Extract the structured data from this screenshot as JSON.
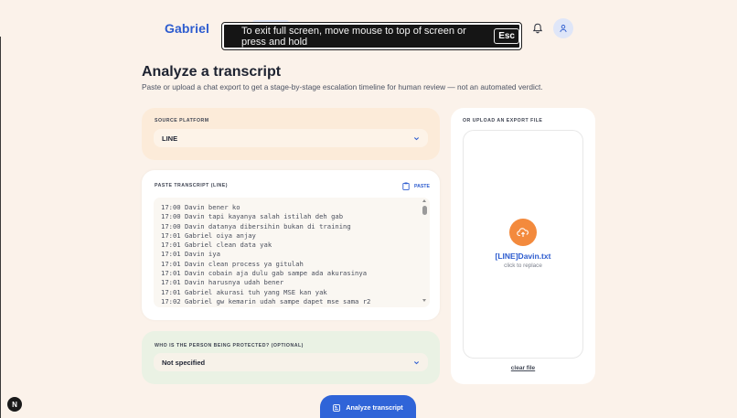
{
  "header": {
    "brand": "Gabriel"
  },
  "fullscreen_notice": {
    "text": "To exit full screen, move mouse to top of screen or press and hold",
    "key": "Esc"
  },
  "page": {
    "title": "Analyze a transcript",
    "subtitle": "Paste or upload a chat export to get a stage-by-stage escalation timeline for human review — not an automated verdict."
  },
  "source_platform": {
    "label": "SOURCE PLATFORM",
    "value": "LINE"
  },
  "transcript": {
    "label": "PASTE TRANSCRIPT (LINE)",
    "paste_label": "PASTE",
    "lines": [
      "17:00 Davin bener ko",
      "17:00 Davin tapi kayanya salah istilah deh gab",
      "17:00 Davin datanya dibersihin bukan di training",
      "17:01 Gabriel oiya anjay",
      "17:01 Gabriel clean data yak",
      "17:01 Davin iya",
      "17:01 Davin clean process ya gitulah",
      "17:01 Davin cobain aja dulu gab sampe ada akurasinya",
      "17:01 Davin harusnya udah bener",
      "17:01 Gabriel akurasi tuh yang MSE kan yak",
      "17:02 Gabriel gw kemarin udah sampe dapet mse sama r2"
    ]
  },
  "protected_person": {
    "label": "WHO IS THE PERSON BEING PROTECTED? (OPTIONAL)",
    "value": "Not specified"
  },
  "upload": {
    "label": "OR UPLOAD AN EXPORT FILE",
    "file_name": "[LINE]Davin.txt",
    "hint": "click to replace",
    "clear_label": "clear file"
  },
  "actions": {
    "analyze_label": "Analyze transcript"
  },
  "badge": {
    "letter": "N"
  },
  "colors": {
    "accent": "#2f64d8",
    "brand": "#2d5ccf",
    "upload_orange": "#f38a3d",
    "background": "#fbf2ea"
  },
  "icons": [
    "bell-icon",
    "user-icon",
    "clipboard-icon",
    "chevron-down-icon",
    "cloud-upload-icon",
    "analyze-icon"
  ]
}
